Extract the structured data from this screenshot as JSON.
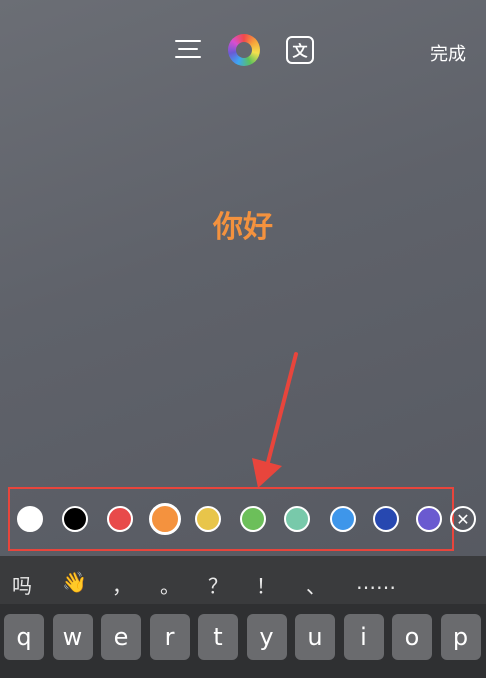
{
  "toolbar": {
    "align_icon": "align-lines-icon",
    "color_icon": "color-wheel-icon",
    "translate_icon": "translate-icon",
    "translate_glyph": "文",
    "done_label": "完成"
  },
  "editor": {
    "text": "你好",
    "text_color": "#f4923e"
  },
  "palette": {
    "colors": [
      {
        "name": "white",
        "hex": "#ffffff"
      },
      {
        "name": "black",
        "hex": "#000000"
      },
      {
        "name": "red",
        "hex": "#e84a4a"
      },
      {
        "name": "orange",
        "hex": "#f4923e",
        "selected": true
      },
      {
        "name": "yellow",
        "hex": "#e8c54a"
      },
      {
        "name": "green",
        "hex": "#6cbf5a"
      },
      {
        "name": "teal",
        "hex": "#78c9aa"
      },
      {
        "name": "blue",
        "hex": "#3e96ea"
      },
      {
        "name": "dark-blue",
        "hex": "#2748b0"
      },
      {
        "name": "purple",
        "hex": "#6a5ad0"
      }
    ],
    "clear_glyph": "✕"
  },
  "suggestions": [
    "吗",
    "👋",
    "，",
    "。",
    "？",
    "！",
    "、",
    "……"
  ],
  "keyboard": {
    "row1": [
      "q",
      "w",
      "e",
      "r",
      "t",
      "y",
      "u",
      "i",
      "o",
      "p"
    ]
  }
}
